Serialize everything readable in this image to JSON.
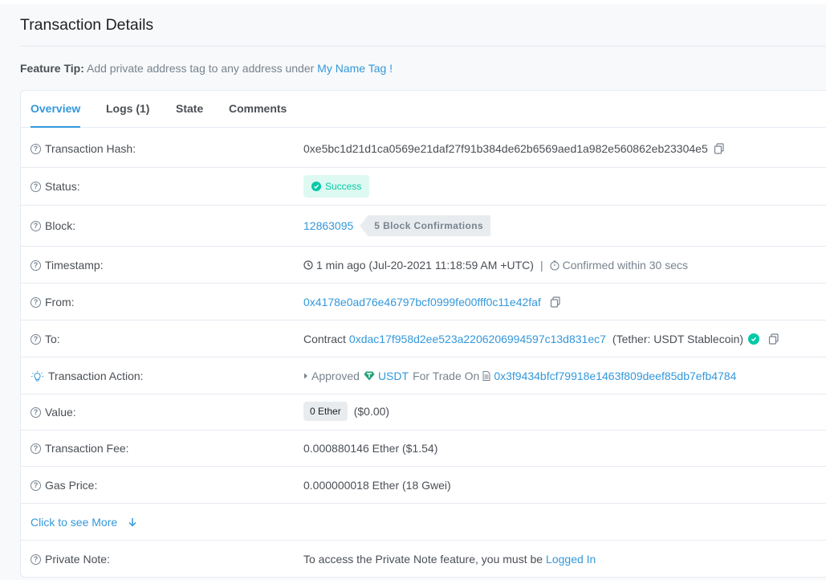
{
  "page": {
    "title": "Transaction Details",
    "feature_tip_label": "Feature Tip:",
    "feature_tip_text": " Add private address tag to any address under ",
    "feature_tip_link": "My Name Tag",
    "feature_tip_end": " !"
  },
  "tabs": [
    {
      "label": "Overview",
      "active": true
    },
    {
      "label": "Logs (1)",
      "active": false
    },
    {
      "label": "State",
      "active": false
    },
    {
      "label": "Comments",
      "active": false
    }
  ],
  "rows": {
    "hash": {
      "label": "Transaction Hash:",
      "value": "0xe5bc1d21d1ca0569e21daf27f91b384de62b6569aed1a982e560862eb23304e5"
    },
    "status": {
      "label": "Status:",
      "value": "Success"
    },
    "block": {
      "label": "Block:",
      "value": "12863095",
      "confirmations": "5 Block Confirmations"
    },
    "timestamp": {
      "label": "Timestamp:",
      "value": "1 min ago (Jul-20-2021 11:18:59 AM +UTC)",
      "separator": "|",
      "confirmed": "Confirmed within 30 secs"
    },
    "from": {
      "label": "From:",
      "value": "0x4178e0ad76e46797bcf0999fe00fff0c11e42faf"
    },
    "to": {
      "label": "To:",
      "prefix": "Contract",
      "address": "0xdac17f958d2ee523a2206206994597c13d831ec7",
      "name": "(Tether: USDT Stablecoin)"
    },
    "action": {
      "label": "Transaction Action:",
      "approved": "Approved",
      "token": "USDT",
      "for_trade_on": "For Trade On",
      "contract": "0x3f9434bfcf79918e1463f809deef85db7efb4784"
    },
    "value": {
      "label": "Value:",
      "badge": "0 Ether",
      "usd": "($0.00)"
    },
    "fee": {
      "label": "Transaction Fee:",
      "value": "0.000880146 Ether ($1.54)"
    },
    "gas": {
      "label": "Gas Price:",
      "value": "0.000000018 Ether (18 Gwei)"
    },
    "more": {
      "label": "Click to see More"
    },
    "note": {
      "label": "Private Note:",
      "text": "To access the Private Note feature, you must be ",
      "link": "Logged In"
    }
  },
  "colors": {
    "link": "#3498db",
    "success": "#00c9a7",
    "success_bg": "#def9f1",
    "text": "#4a4f55",
    "muted": "#77838f"
  }
}
